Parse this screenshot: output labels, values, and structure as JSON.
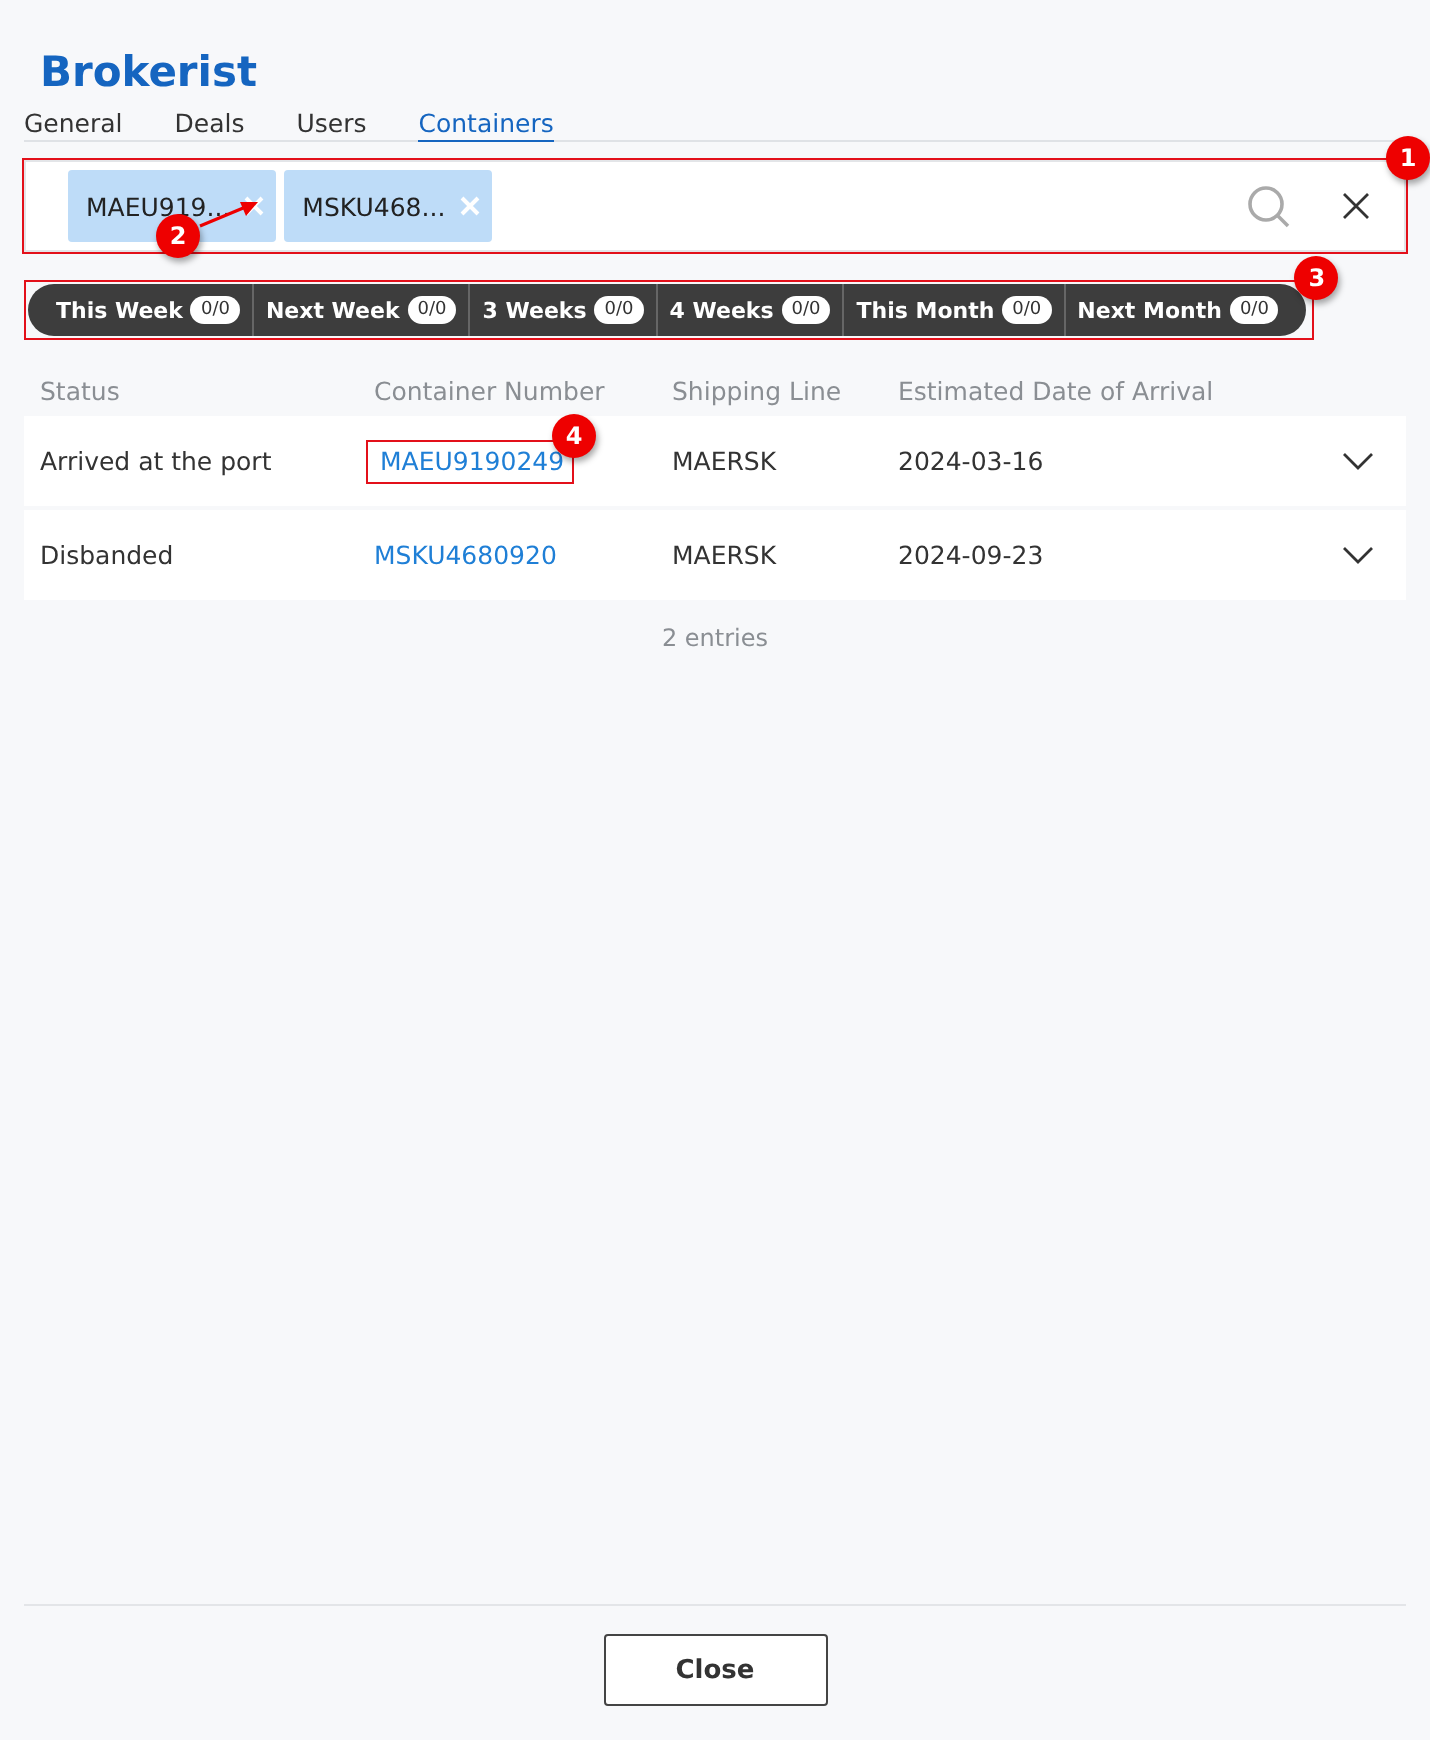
{
  "app_title": "Brokerist",
  "tabs": [
    {
      "label": "General",
      "selected": false
    },
    {
      "label": "Deals",
      "selected": false
    },
    {
      "label": "Users",
      "selected": false
    },
    {
      "label": "Containers",
      "selected": true
    }
  ],
  "search": {
    "callout": "1",
    "chips": [
      {
        "label": "MAEU919...",
        "callout": "2"
      },
      {
        "label": "MSKU468..."
      }
    ]
  },
  "filter_bar": {
    "callout": "3",
    "filters": [
      {
        "label": "This Week",
        "count": "0/0"
      },
      {
        "label": "Next Week",
        "count": "0/0"
      },
      {
        "label": "3 Weeks",
        "count": "0/0"
      },
      {
        "label": "4 Weeks",
        "count": "0/0"
      },
      {
        "label": "This Month",
        "count": "0/0"
      },
      {
        "label": "Next Month",
        "count": "0/0"
      }
    ]
  },
  "table": {
    "columns": [
      "Status",
      "Container Number",
      "Shipping Line",
      "Estimated Date of Arrival"
    ],
    "rows": [
      {
        "status": "Arrived at the port",
        "container": "MAEU9190249",
        "line": "MAERSK",
        "eta": "2024-03-16",
        "callout": "4"
      },
      {
        "status": "Disbanded",
        "container": "MSKU4680920",
        "line": "MAERSK",
        "eta": "2024-09-23"
      }
    ],
    "footer": "2 entries"
  },
  "buttons": [
    "Close"
  ]
}
